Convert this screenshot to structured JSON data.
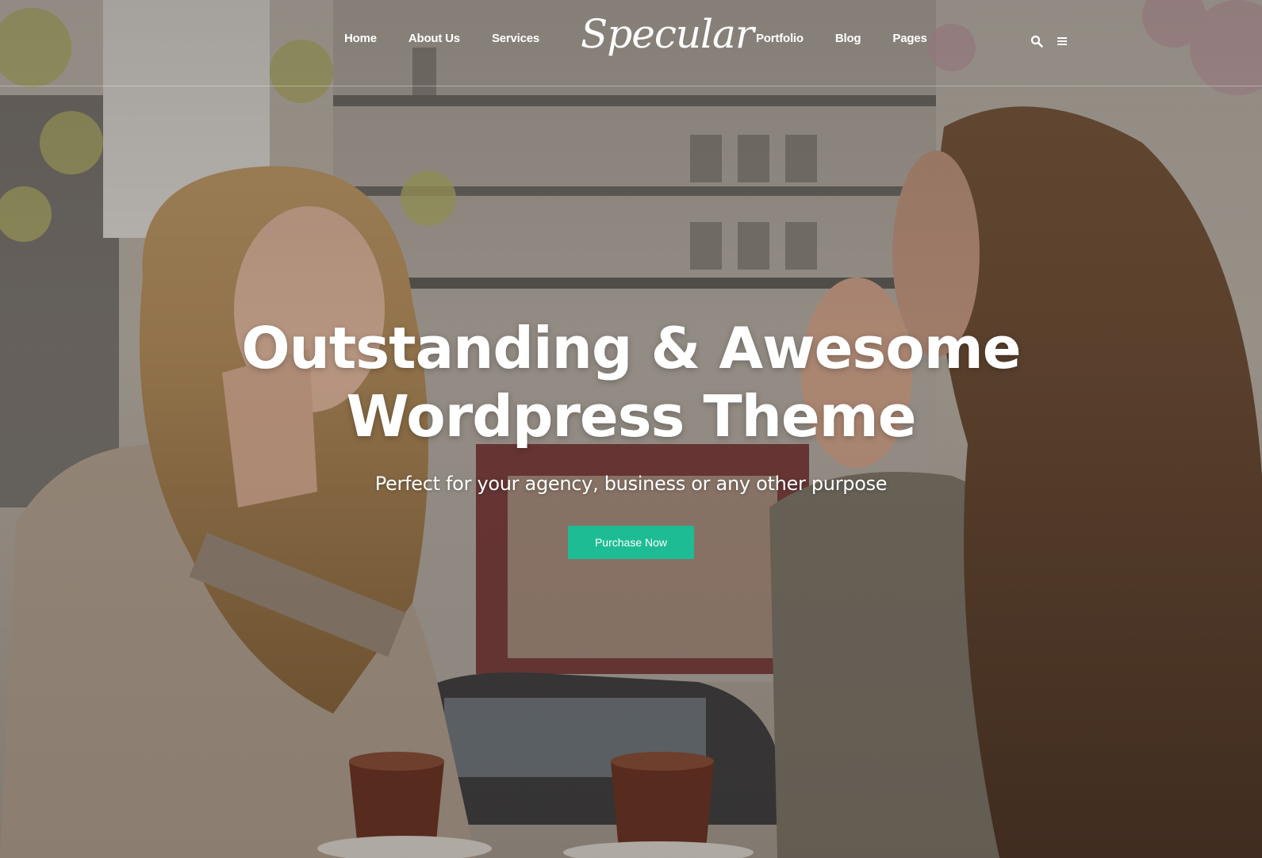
{
  "header": {
    "logo": "Specular",
    "nav_left": [
      {
        "label": "Home"
      },
      {
        "label": "About Us"
      },
      {
        "label": "Services"
      }
    ],
    "nav_right": [
      {
        "label": "Portfolio"
      },
      {
        "label": "Blog"
      },
      {
        "label": "Pages"
      }
    ],
    "icons": {
      "search": "search-icon",
      "menu": "hamburger-menu-icon"
    }
  },
  "hero": {
    "headline_line1": "Outstanding & Awesome",
    "headline_line2": "Wordpress Theme",
    "subtitle": "Perfect for your agency, business or any other purpose",
    "cta_label": "Purchase Now"
  },
  "colors": {
    "accent": "#1dbc94",
    "text": "#ffffff"
  }
}
